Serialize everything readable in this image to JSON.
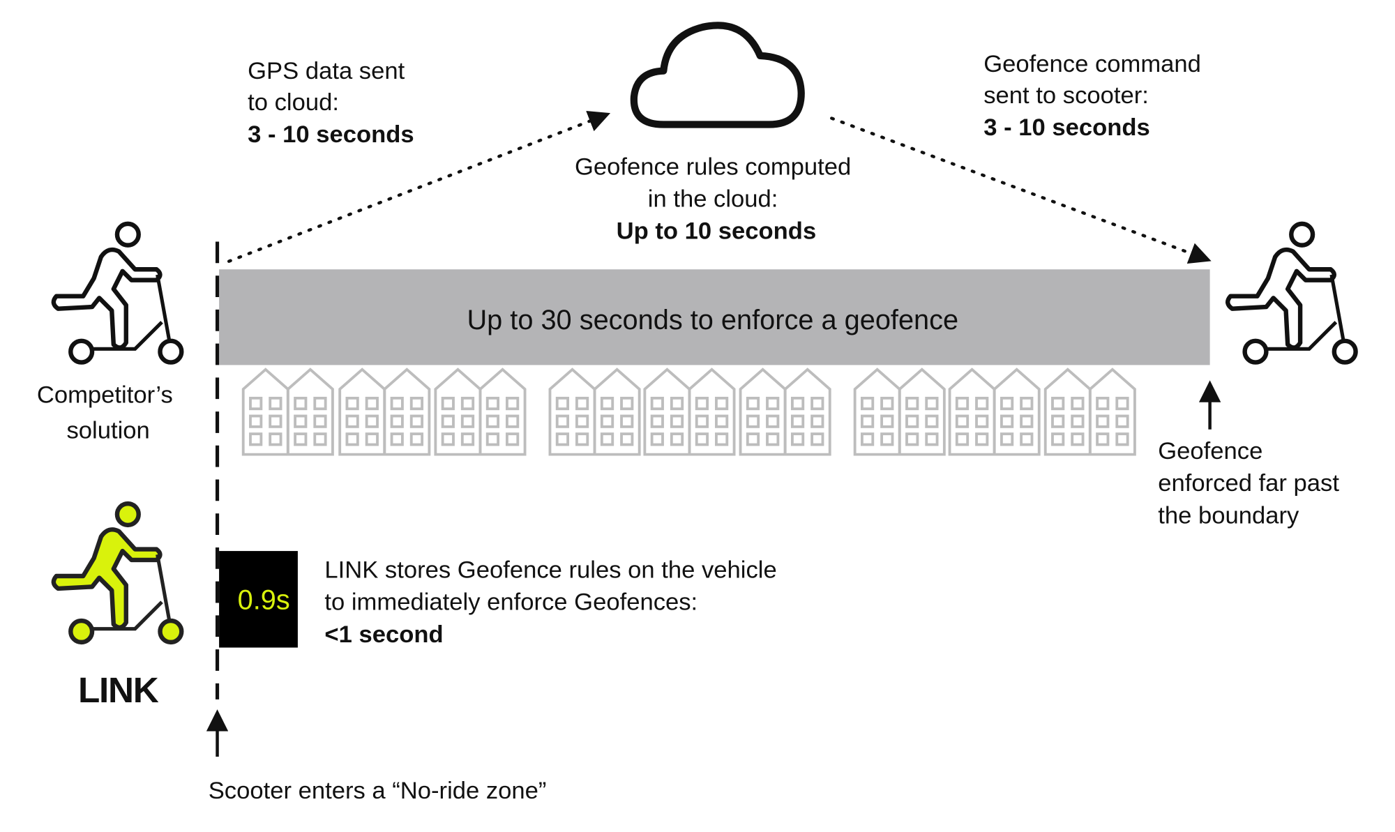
{
  "colors": {
    "accent_yellow": "#d9f20c",
    "bar_gray": "#b4b4b6",
    "building_gray": "#bdbdbd",
    "box_black": "#000000"
  },
  "icons": [
    "scooter-rider-icon",
    "cloud-icon",
    "building-icon",
    "arrow-up-icon"
  ],
  "gps_note": {
    "line1": "GPS data sent",
    "line2": "to cloud:",
    "time": "3 - 10 seconds"
  },
  "command_note": {
    "line1": "Geofence command",
    "line2": "sent to scooter:",
    "time": "3 - 10 seconds"
  },
  "cloud_note": {
    "line1": "Geofence rules computed",
    "line2": "in the cloud:",
    "time": "Up to 10 seconds"
  },
  "bar_label": "Up to 30 seconds to enforce a geofence",
  "competitor": {
    "line1": "Competitor’s",
    "line2": "solution"
  },
  "enforced_note": {
    "line1": "Geofence",
    "line2": "enforced far past",
    "line3": "the boundary"
  },
  "link": {
    "logo": "LINK",
    "box_value": "0.9s",
    "line1": "LINK stores Geofence rules on the vehicle",
    "line2": "to immediately enforce Geofences:",
    "time": "<1 second"
  },
  "entry_note": "Scooter enters a “No-ride zone”"
}
